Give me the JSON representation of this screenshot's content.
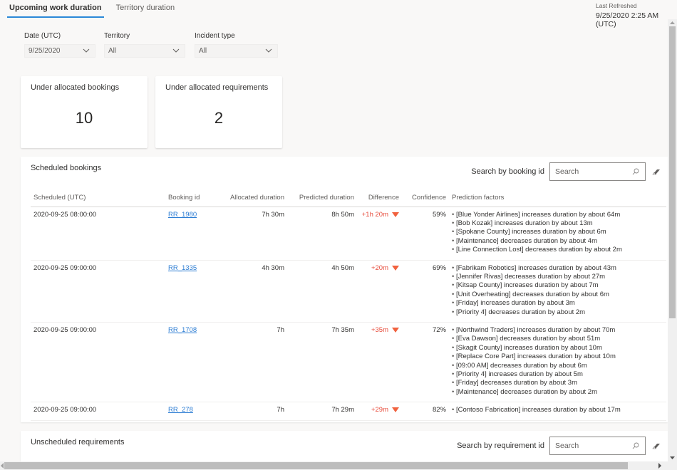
{
  "tabs": [
    {
      "label": "Upcoming work duration",
      "active": true
    },
    {
      "label": "Territory duration",
      "active": false
    }
  ],
  "last_refreshed": {
    "label": "Last Refreshed",
    "value": "9/25/2020 2:25 AM (UTC)"
  },
  "filters": [
    {
      "label": "Date (UTC)",
      "value": "9/25/2020"
    },
    {
      "label": "Territory",
      "value": "All"
    },
    {
      "label": "Incident type",
      "value": "All"
    }
  ],
  "kpis": [
    {
      "title": "Under allocated bookings",
      "value": "10"
    },
    {
      "title": "Under allocated requirements",
      "value": "2"
    }
  ],
  "scheduled_bookings": {
    "title": "Scheduled bookings",
    "search_label": "Search by booking id",
    "search_placeholder": "Search",
    "columns": [
      "Scheduled (UTC)",
      "Booking id",
      "Allocated duration",
      "Predicted duration",
      "Difference",
      "Confidence",
      "Prediction factors"
    ],
    "rows": [
      {
        "scheduled": "2020-09-25 08:00:00",
        "booking_id": "RR_1980",
        "allocated": "7h 30m",
        "predicted": "8h 50m",
        "difference": "+1h 20m",
        "difference_trend": "triangle-down",
        "confidence": "59%",
        "factors": [
          "[Blue Yonder Airlines] increases duration by about 64m",
          "[Bob Kozak] increases duration by about 13m",
          "[Spokane County] increases duration by about 6m",
          "[Maintenance] decreases duration by about 4m",
          "[Line Connection Lost] decreases duration by about 2m"
        ]
      },
      {
        "scheduled": "2020-09-25 09:00:00",
        "booking_id": "RR_1335",
        "allocated": "4h 30m",
        "predicted": "4h 50m",
        "difference": "+20m",
        "difference_trend": "triangle-down",
        "confidence": "69%",
        "factors": [
          "[Fabrikam Robotics] increases duration by about 43m",
          "[Jennifer Rivas] decreases duration by about 27m",
          "[Kitsap County] increases duration by about 7m",
          "[Unit Overheating] decreases duration by about 6m",
          "[Friday] increases duration by about 3m",
          "[Priority 4] decreases duration by about 2m"
        ]
      },
      {
        "scheduled": "2020-09-25 09:00:00",
        "booking_id": "RR_1708",
        "allocated": "7h",
        "predicted": "7h 35m",
        "difference": "+35m",
        "difference_trend": "triangle-down",
        "confidence": "72%",
        "factors": [
          "[Northwind Traders] increases duration by about 70m",
          "[Eva Dawson] decreases duration by about 51m",
          "[Skagit County] increases duration by about 10m",
          "[Replace Core Part] increases duration by about 10m",
          "[09:00 AM] decreases duration by about 6m",
          "[Priority 4] increases duration by about 5m",
          "[Friday] decreases duration by about 3m",
          "[Maintenance] decreases duration by about 2m"
        ]
      },
      {
        "scheduled": "2020-09-25 09:00:00",
        "booking_id": "RR_278",
        "allocated": "7h",
        "predicted": "7h 29m",
        "difference": "+29m",
        "difference_trend": "triangle-down",
        "confidence": "82%",
        "factors": [
          "[Contoso Fabrication] increases duration by about 17m"
        ]
      }
    ]
  },
  "unscheduled_requirements": {
    "title": "Unscheduled requirements",
    "search_label": "Search by requirement id",
    "search_placeholder": "Search"
  },
  "colors": {
    "accent": "#2b88d8",
    "link": "#2b7cd3",
    "negative": "#e74c3c",
    "triangle": "#f1623f",
    "background": "#f9f8f7"
  }
}
